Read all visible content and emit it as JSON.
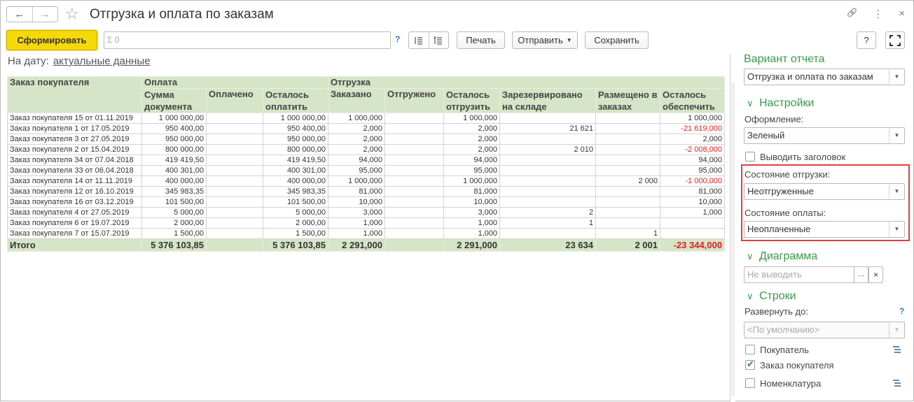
{
  "window": {
    "title": "Отгрузка и оплата по заказам",
    "back_icon": "←",
    "forward_icon": "→",
    "favorite_icon": "☆",
    "link_icon": "🔗",
    "more_icon": "⋮",
    "close_icon": "×"
  },
  "toolbar": {
    "generate_label": "Сформировать",
    "sum_placeholder": "Σ 0",
    "help": "?",
    "print_label": "Печать",
    "send_label": "Отправить",
    "save_label": "Сохранить",
    "help_right": "?"
  },
  "date": {
    "label": "На дату:",
    "link": "актуальные данные"
  },
  "table": {
    "h_order": "Заказ покупателя",
    "h_payment": "Оплата",
    "h_shipment": "Отгрузка",
    "h_sum": "Сумма документа",
    "h_paid": "Оплачено",
    "h_topay": "Осталось оплатить",
    "h_ordered": "Заказано",
    "h_shipped": "Отгружено",
    "h_toship": "Осталось отгрузить",
    "h_reserved": "Зарезервировано на складе",
    "h_placed": "Размещено в заказах",
    "h_toprovide": "Осталось обеспечить",
    "rows": [
      {
        "order": "Заказ покупателя 15 от 01.11.2019",
        "sum": "1 000 000,00",
        "paid": "",
        "topay": "1 000 000,00",
        "ordered": "1 000,000",
        "shipped": "",
        "toship": "1 000,000",
        "reserved": "",
        "placed": "",
        "toprovide": "1 000,000",
        "neg": false
      },
      {
        "order": "Заказ покупателя 1 от 17.05.2019",
        "sum": "950 400,00",
        "paid": "",
        "topay": "950 400,00",
        "ordered": "2,000",
        "shipped": "",
        "toship": "2,000",
        "reserved": "21 621",
        "placed": "",
        "toprovide": "-21 619,000",
        "neg": true
      },
      {
        "order": "Заказ покупателя 3 от 27.05.2019",
        "sum": "950 000,00",
        "paid": "",
        "topay": "950 000,00",
        "ordered": "2,000",
        "shipped": "",
        "toship": "2,000",
        "reserved": "",
        "placed": "",
        "toprovide": "2,000",
        "neg": false
      },
      {
        "order": "Заказ покупателя 2 от 15.04.2019",
        "sum": "800 000,00",
        "paid": "",
        "topay": "800 000,00",
        "ordered": "2,000",
        "shipped": "",
        "toship": "2,000",
        "reserved": "2 010",
        "placed": "",
        "toprovide": "-2 008,000",
        "neg": true
      },
      {
        "order": "Заказ покупателя 34 от 07.04.2018",
        "sum": "419 419,50",
        "paid": "",
        "topay": "419 419,50",
        "ordered": "94,000",
        "shipped": "",
        "toship": "94,000",
        "reserved": "",
        "placed": "",
        "toprovide": "94,000",
        "neg": false
      },
      {
        "order": "Заказ покупателя 33 от 06.04.2018",
        "sum": "400 301,00",
        "paid": "",
        "topay": "400 301,00",
        "ordered": "95,000",
        "shipped": "",
        "toship": "95,000",
        "reserved": "",
        "placed": "",
        "toprovide": "95,000",
        "neg": false
      },
      {
        "order": "Заказ покупателя 14 от 11.11.2019",
        "sum": "400 000,00",
        "paid": "",
        "topay": "400 000,00",
        "ordered": "1 000,000",
        "shipped": "",
        "toship": "1 000,000",
        "reserved": "",
        "placed": "2 000",
        "toprovide": "-1 000,000",
        "neg": true
      },
      {
        "order": "Заказ покупателя 12 от 16.10.2019",
        "sum": "345 983,35",
        "paid": "",
        "topay": "345 983,35",
        "ordered": "81,000",
        "shipped": "",
        "toship": "81,000",
        "reserved": "",
        "placed": "",
        "toprovide": "81,000",
        "neg": false
      },
      {
        "order": "Заказ покупателя 16 от 03.12.2019",
        "sum": "101 500,00",
        "paid": "",
        "topay": "101 500,00",
        "ordered": "10,000",
        "shipped": "",
        "toship": "10,000",
        "reserved": "",
        "placed": "",
        "toprovide": "10,000",
        "neg": false
      },
      {
        "order": "Заказ покупателя 4 от 27.05.2019",
        "sum": "5 000,00",
        "paid": "",
        "topay": "5 000,00",
        "ordered": "3,000",
        "shipped": "",
        "toship": "3,000",
        "reserved": "2",
        "placed": "",
        "toprovide": "1,000",
        "neg": false
      },
      {
        "order": "Заказ покупателя 6 от 19.07.2019",
        "sum": "2 000,00",
        "paid": "",
        "topay": "2 000,00",
        "ordered": "1,000",
        "shipped": "",
        "toship": "1,000",
        "reserved": "1",
        "placed": "",
        "toprovide": "",
        "neg": false
      },
      {
        "order": "Заказ покупателя 7 от 15.07.2019",
        "sum": "1 500,00",
        "paid": "",
        "topay": "1 500,00",
        "ordered": "1,000",
        "shipped": "",
        "toship": "1,000",
        "reserved": "",
        "placed": "1",
        "toprovide": "",
        "neg": false
      }
    ],
    "total": {
      "order": "Итого",
      "sum": "5 376 103,85",
      "paid": "",
      "topay": "5 376 103,85",
      "ordered": "2 291,000",
      "shipped": "",
      "toship": "2 291,000",
      "reserved": "23 634",
      "placed": "2 001",
      "toprovide": "-23 344,000",
      "neg": true
    }
  },
  "panel": {
    "variant_title": "Вариант отчета",
    "variant_value": "Отгрузка и оплата по заказам",
    "settings_title": "Настройки",
    "design_label": "Оформление:",
    "design_value": "Зеленый",
    "show_title_label": "Выводить заголовок",
    "ship_state_label": "Состояние отгрузки:",
    "ship_state_value": "Неотгруженные",
    "pay_state_label": "Состояние оплаты:",
    "pay_state_value": "Неоплаченные",
    "diagram_title": "Диаграмма",
    "diagram_placeholder": "Не выводить",
    "rows_title": "Строки",
    "expand_label": "Развернуть до:",
    "expand_value": "<По умолчанию>",
    "help": "?",
    "chk_buyer": "Покупатель",
    "chk_order": "Заказ покупателя",
    "chk_nomen": "Номенклатура"
  },
  "colors": {
    "header_bg": "#d6e4c7",
    "accent_green": "#3a9a4a",
    "negative_red": "#e02020",
    "button_yellow": "#f5d80a",
    "highlight_red": "#e04040"
  }
}
